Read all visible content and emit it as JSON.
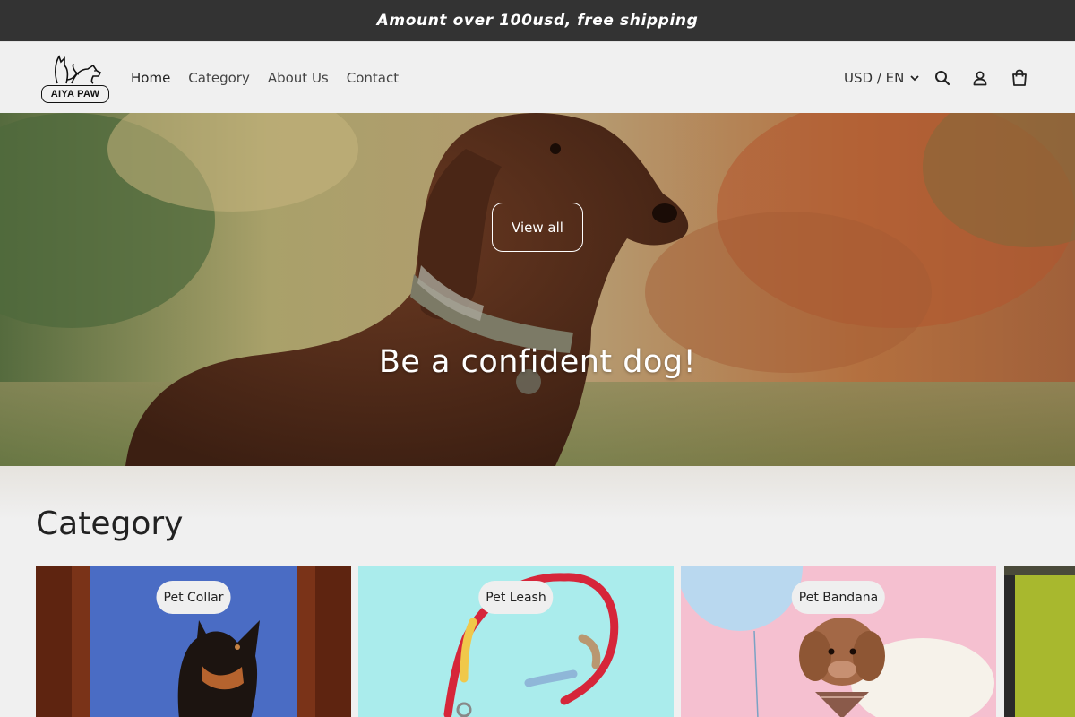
{
  "announcement": "Amount over 100usd, free shipping",
  "brand": {
    "logo_text": "AIYA PAW"
  },
  "nav": {
    "items": [
      {
        "label": "Home"
      },
      {
        "label": "Category"
      },
      {
        "label": "About Us"
      },
      {
        "label": "Contact"
      }
    ]
  },
  "header": {
    "locale_label": "USD / EN",
    "icons": [
      "chevron-down-icon",
      "search-icon",
      "account-icon",
      "cart-icon"
    ]
  },
  "hero": {
    "button_label": "View all",
    "title": "Be a confident dog!"
  },
  "category": {
    "title": "Category",
    "cards": [
      {
        "label": "Pet Collar"
      },
      {
        "label": "Pet Leash"
      },
      {
        "label": "Pet Bandana"
      },
      {
        "label": ""
      }
    ]
  },
  "colors": {
    "announcement_bg": "#333333",
    "header_bg": "#f0f0f0",
    "page_bg": "#f2f2f2",
    "text_primary": "#222222"
  }
}
